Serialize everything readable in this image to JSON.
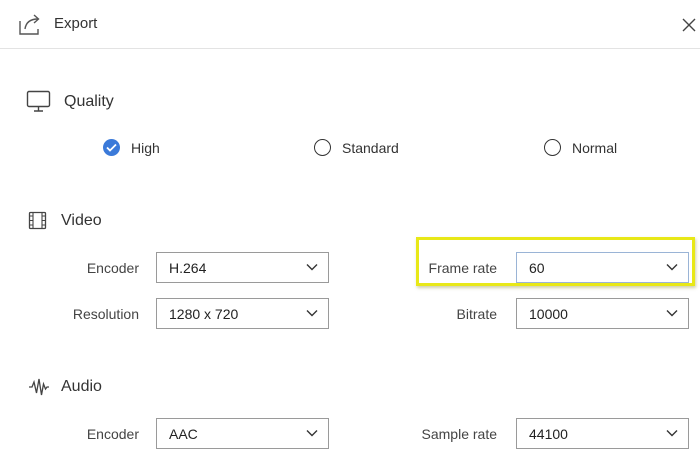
{
  "window": {
    "title": "Export"
  },
  "quality": {
    "title": "Quality",
    "options": [
      {
        "label": "High",
        "selected": true
      },
      {
        "label": "Standard",
        "selected": false
      },
      {
        "label": "Normal",
        "selected": false
      }
    ]
  },
  "video": {
    "title": "Video",
    "encoder": {
      "label": "Encoder",
      "value": "H.264"
    },
    "frame_rate": {
      "label": "Frame rate",
      "value": "60"
    },
    "resolution": {
      "label": "Resolution",
      "value": "1280 x 720"
    },
    "bitrate": {
      "label": "Bitrate",
      "value": "10000"
    }
  },
  "audio": {
    "title": "Audio",
    "encoder": {
      "label": "Encoder",
      "value": "AAC"
    },
    "sample_rate": {
      "label": "Sample rate",
      "value": "44100"
    }
  },
  "colors": {
    "accent": "#3b7ad9",
    "highlight": "#e8e817"
  }
}
